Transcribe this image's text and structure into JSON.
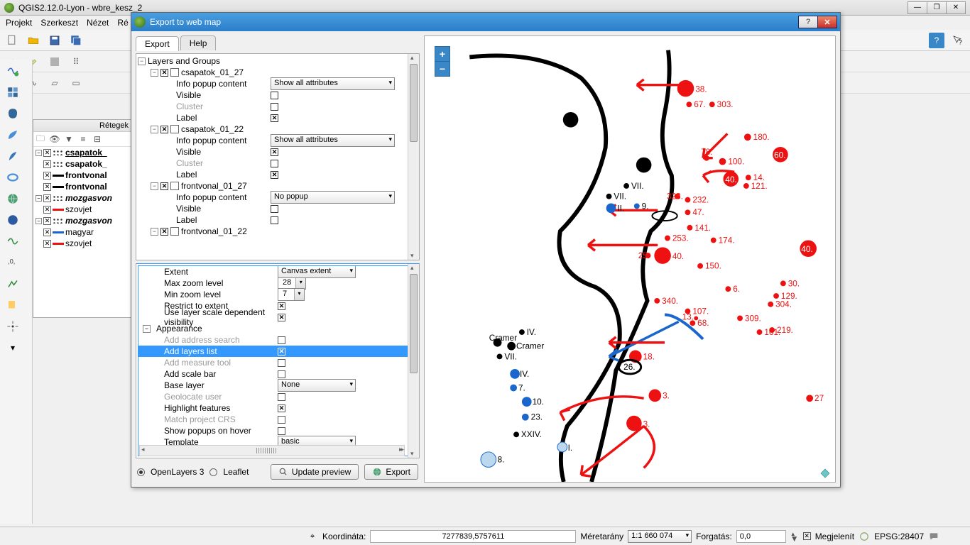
{
  "main_window": {
    "title": "QGIS2.12.0-Lyon - wbre_kesz_2",
    "menu": [
      "Projekt",
      "Szerkeszt",
      "Nézet",
      "Ré"
    ],
    "win_buttons": {
      "min": "—",
      "max": "❐",
      "close": "✕"
    }
  },
  "layers_panel": {
    "title": "Rétegek",
    "items": [
      {
        "kind": "group",
        "expanded": true,
        "checked": true,
        "name": "csapatok_",
        "bold": true,
        "underline": true,
        "swatch": ""
      },
      {
        "kind": "layer",
        "checked": true,
        "swatch_type": "dots",
        "name": "csapatok_",
        "bold": true
      },
      {
        "kind": "layer",
        "checked": true,
        "swatch_type": "line-black",
        "name": "frontvonal",
        "bold": true
      },
      {
        "kind": "layer",
        "checked": true,
        "swatch_type": "line-black",
        "name": "frontvonal",
        "bold": true
      },
      {
        "kind": "group",
        "expanded": true,
        "checked": true,
        "name": "mozgasvon",
        "bold": true,
        "italic": true,
        "swatch": ""
      },
      {
        "kind": "layer",
        "checked": true,
        "swatch_type": "line-red",
        "name": "szovjet",
        "bold": false
      },
      {
        "kind": "group",
        "expanded": true,
        "checked": true,
        "name": "mozgasvon",
        "bold": true,
        "italic": true,
        "swatch": ""
      },
      {
        "kind": "layer",
        "checked": true,
        "swatch_type": "line-blue",
        "name": "magyar",
        "bold": false
      },
      {
        "kind": "layer",
        "checked": true,
        "swatch_type": "line-red",
        "name": "szovjet",
        "bold": false
      }
    ]
  },
  "dialog": {
    "title": "Export to web map",
    "tabs": {
      "export": "Export",
      "help": "Help"
    },
    "tree": {
      "root": "Layers and Groups",
      "nodes": [
        {
          "name": "csapatok_01_27",
          "rows": [
            {
              "label": "Info popup content",
              "control": "dropdown",
              "value": "Show all attributes"
            },
            {
              "label": "Visible",
              "control": "checkbox",
              "on": false
            },
            {
              "label": "Cluster",
              "control": "checkbox",
              "on": false,
              "disabled": true
            },
            {
              "label": "Label",
              "control": "checkbox",
              "on": true
            }
          ]
        },
        {
          "name": "csapatok_01_22",
          "rows": [
            {
              "label": "Info popup content",
              "control": "dropdown",
              "value": "Show all attributes"
            },
            {
              "label": "Visible",
              "control": "checkbox",
              "on": true
            },
            {
              "label": "Cluster",
              "control": "checkbox",
              "on": false,
              "disabled": true
            },
            {
              "label": "Label",
              "control": "checkbox",
              "on": true
            }
          ]
        },
        {
          "name": "frontvonal_01_27",
          "rows": [
            {
              "label": "Info popup content",
              "control": "dropdown",
              "value": "No popup"
            },
            {
              "label": "Visible",
              "control": "checkbox",
              "on": false
            },
            {
              "label": "Label",
              "control": "checkbox",
              "on": false
            }
          ]
        },
        {
          "name": "frontvonal_01_22",
          "rows": []
        }
      ]
    },
    "options": [
      {
        "label": "Extent",
        "control": "dropdown",
        "value": "Canvas extent"
      },
      {
        "label": "Max zoom level",
        "control": "spinner",
        "value": "28"
      },
      {
        "label": "Min zoom level",
        "control": "spinner",
        "value": "7"
      },
      {
        "label": "Restrict to extent",
        "control": "checkbox",
        "on": true
      },
      {
        "label": "Use layer scale dependent visibility",
        "control": "checkbox",
        "on": true
      },
      {
        "label": "Appearance",
        "control": "header"
      },
      {
        "label": "Add address search",
        "control": "checkbox",
        "on": false,
        "disabled": true
      },
      {
        "label": "Add layers list",
        "control": "checkbox",
        "on": true,
        "selected": true
      },
      {
        "label": "Add measure tool",
        "control": "checkbox",
        "on": false,
        "disabled": true
      },
      {
        "label": "Add scale bar",
        "control": "checkbox",
        "on": false
      },
      {
        "label": "Base layer",
        "control": "dropdown",
        "value": "None"
      },
      {
        "label": "Geolocate user",
        "control": "checkbox",
        "on": false,
        "disabled": true
      },
      {
        "label": "Highlight features",
        "control": "checkbox",
        "on": true
      },
      {
        "label": "Match project CRS",
        "control": "checkbox",
        "on": false,
        "disabled": true
      },
      {
        "label": "Show popups on hover",
        "control": "checkbox",
        "on": false
      },
      {
        "label": "Template",
        "control": "dropdown",
        "value": "basic"
      }
    ],
    "radios": {
      "ol": "OpenLayers 3",
      "leaflet": "Leaflet",
      "selected": "ol"
    },
    "buttons": {
      "update": "Update preview",
      "export": "Export"
    }
  },
  "statusbar": {
    "coord_label": "Koordináta:",
    "coord_value": "7277839,5757611",
    "scale_label": "Méretarány",
    "scale_value": "1:1 660 074",
    "rotation_label": "Forgatás:",
    "rotation_value": "0,0",
    "render_label": "Megjelenít",
    "crs": "EPSG:28407"
  }
}
